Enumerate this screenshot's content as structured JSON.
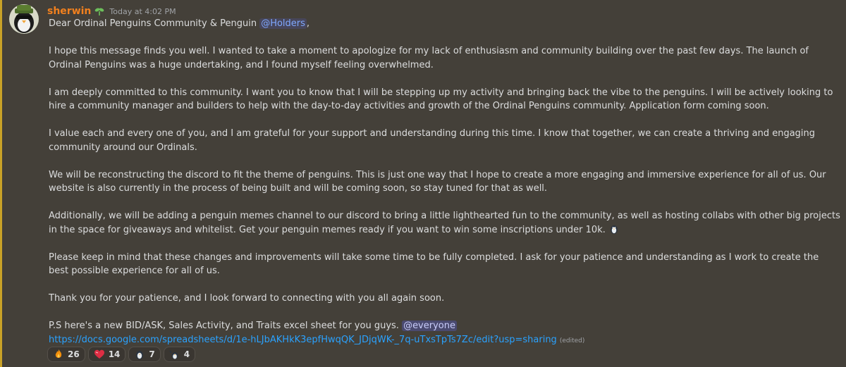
{
  "message": {
    "username": "sherwin",
    "timestamp": "Today at 4:02 PM",
    "greeting_prefix": "Dear Ordinal Penguins Community & Penguin ",
    "greeting_mention": "@Holders",
    "greeting_suffix": ",",
    "paragraphs": [
      "I hope this message finds you well. I wanted to take a moment to apologize for my lack of enthusiasm and community building over the past few days. The launch of Ordinal Penguins was a huge undertaking, and I found myself feeling overwhelmed.",
      "I am deeply committed to this community. I want you to know that I will be stepping up my activity and bringing back the vibe to the penguins. I will be actively looking to hire a community manager and builders to help with the day-to-day activities and growth of the Ordinal Penguins community. Application form coming soon.",
      "I value each and every one of you, and I am grateful for your support and understanding during this time. I know that together, we can create a thriving and engaging community around our Ordinals.",
      "We will be reconstructing the discord to fit the theme of penguins. This is just one way that I hope to create a more engaging and immersive experience for all of us. Our website is also currently in the process of being built and will be coming soon, so stay tuned for that as well.",
      "Additionally, we will be adding a penguin memes channel to our discord to bring a little lighthearted fun to the community, as well as hosting collabs with other big projects in the space for giveaways and whitelist. Get your penguin memes ready if you want to win some inscriptions under 10k.",
      "Please keep in mind that these changes and improvements will take some time to be fully completed. I ask for your patience and understanding as I work to create the best possible experience for all of us.",
      "Thank you for your patience, and I look forward to connecting with you all again soon."
    ],
    "ps_text": "P.S here's a new BID/ASK, Sales Activity, and Traits excel sheet for you guys. ",
    "ps_mention": "@everyone",
    "link": "https://docs.google.com/spreadsheets/d/1e-hLJbAKHkK3epfHwqQK_JDjqWK-_7q-uTxsTpTs7Zc/edit?usp=sharing",
    "edited": "(edited)"
  },
  "reactions": [
    {
      "icon": "fire-icon",
      "count": "26"
    },
    {
      "icon": "heart-icon",
      "count": "14"
    },
    {
      "icon": "penguin-icon",
      "count": "7"
    },
    {
      "icon": "penguin-wave-icon",
      "count": "4"
    }
  ],
  "colors": {
    "background": "#444039",
    "username": "#f1801e",
    "link": "#2aa2ff",
    "mention_bg": "#5865f2",
    "highlight_bar": "#c9a227"
  }
}
